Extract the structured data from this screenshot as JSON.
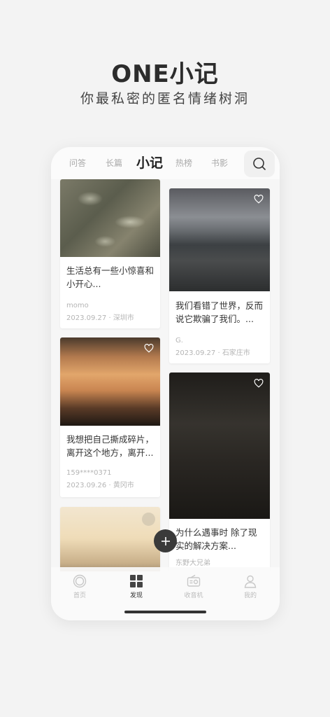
{
  "hero": {
    "title": "ONE小记",
    "subtitle": "你最私密的匿名情绪树洞"
  },
  "tabs": [
    "问答",
    "长篇",
    "小记",
    "热榜",
    "书影"
  ],
  "active_tab": "小记",
  "cards": [
    {
      "text": "生活总有一些小惊喜和小开心...",
      "author": "momo",
      "date": "2023.09.27",
      "location": "深圳市"
    },
    {
      "text": "我们看错了世界，反而说它欺骗了我们。...",
      "author": "G.",
      "date": "2023.09.27",
      "location": "石家庄市"
    },
    {
      "text": "我想把自己撕成碎片，离开这个地方，离开...",
      "author": "159****0371",
      "date": "2023.09.26",
      "location": "黄冈市"
    },
    {
      "text": "为什么遇事时 除了现实的解决方案...",
      "author": "东野大兄弟",
      "date": "",
      "location": ""
    }
  ],
  "bottom_nav": [
    {
      "label": "首页",
      "icon": "home-ring-icon"
    },
    {
      "label": "发现",
      "icon": "grid-icon"
    },
    {
      "label": "收音机",
      "icon": "radio-icon"
    },
    {
      "label": "我的",
      "icon": "person-icon"
    }
  ],
  "active_nav": "发现",
  "colors": {
    "accent": "#333333",
    "background": "#f3f3f3",
    "muted": "#b5b5b5"
  }
}
